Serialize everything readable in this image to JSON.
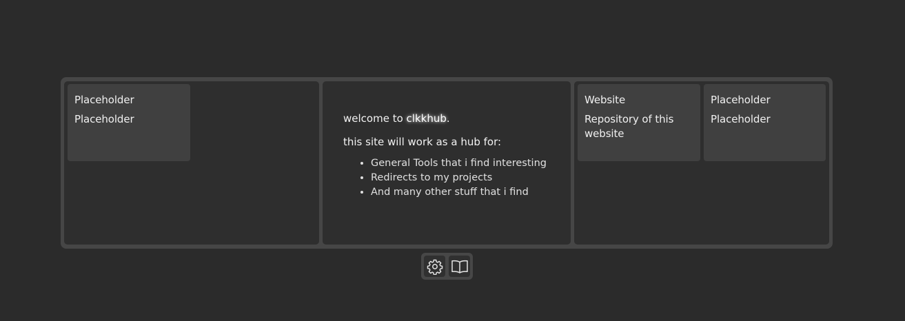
{
  "left_panel": {
    "card1": {
      "links": [
        "Placeholder",
        "Placeholder"
      ]
    }
  },
  "center_panel": {
    "welcome_prefix": "welcome to ",
    "brand": "clkkhub",
    "welcome_suffix": ".",
    "intro": "this site will work as a hub for:",
    "items": [
      "General Tools that i find interesting",
      "Redirects to my projects",
      "And many other stuff that i find"
    ]
  },
  "right_panel": {
    "card1": {
      "links": [
        "Website",
        "Repository of this website"
      ]
    },
    "card2": {
      "links": [
        "Placeholder",
        "Placeholder"
      ]
    }
  },
  "toolbar": {
    "buttons": [
      {
        "icon": "gear-icon"
      },
      {
        "icon": "book-icon"
      }
    ]
  },
  "colors": {
    "background": "#2b2b2b",
    "frame": "#464646",
    "panel": "#2e2e2e",
    "card": "#404040",
    "text": "#e8e8e8"
  }
}
